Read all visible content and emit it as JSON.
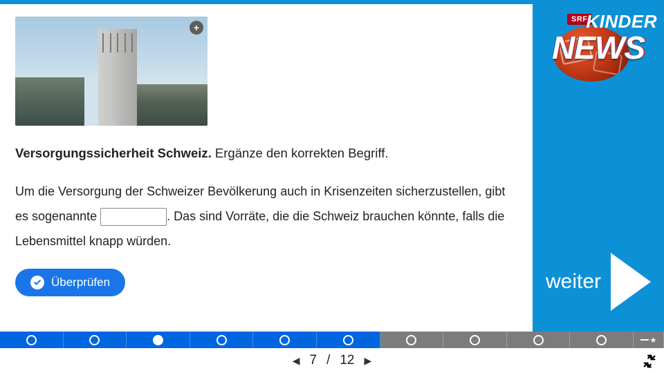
{
  "question": {
    "title_bold": "Versorgungssicherheit Schweiz.",
    "title_rest": "Ergänze den korrekten Begriff.",
    "text_before": "Um die Versorgung der Schweizer Bevölkerung auch in Krisenzeiten sicherzustellen, gibt es sogenannte ",
    "text_after": ". Das sind Vorräte, die die Schweiz brauchen könnte, falls die Lebensmittel knapp würden.",
    "blank_value": ""
  },
  "buttons": {
    "check": "Überprüfen",
    "next": "weiter"
  },
  "logo": {
    "badge": "SRF",
    "line1": "KINDER",
    "line2": "NEWS"
  },
  "pagination": {
    "current": "7",
    "sep": "/",
    "total": "12"
  },
  "progress": {
    "total_segments": 10,
    "completed_through": 6,
    "current_index": 3
  }
}
